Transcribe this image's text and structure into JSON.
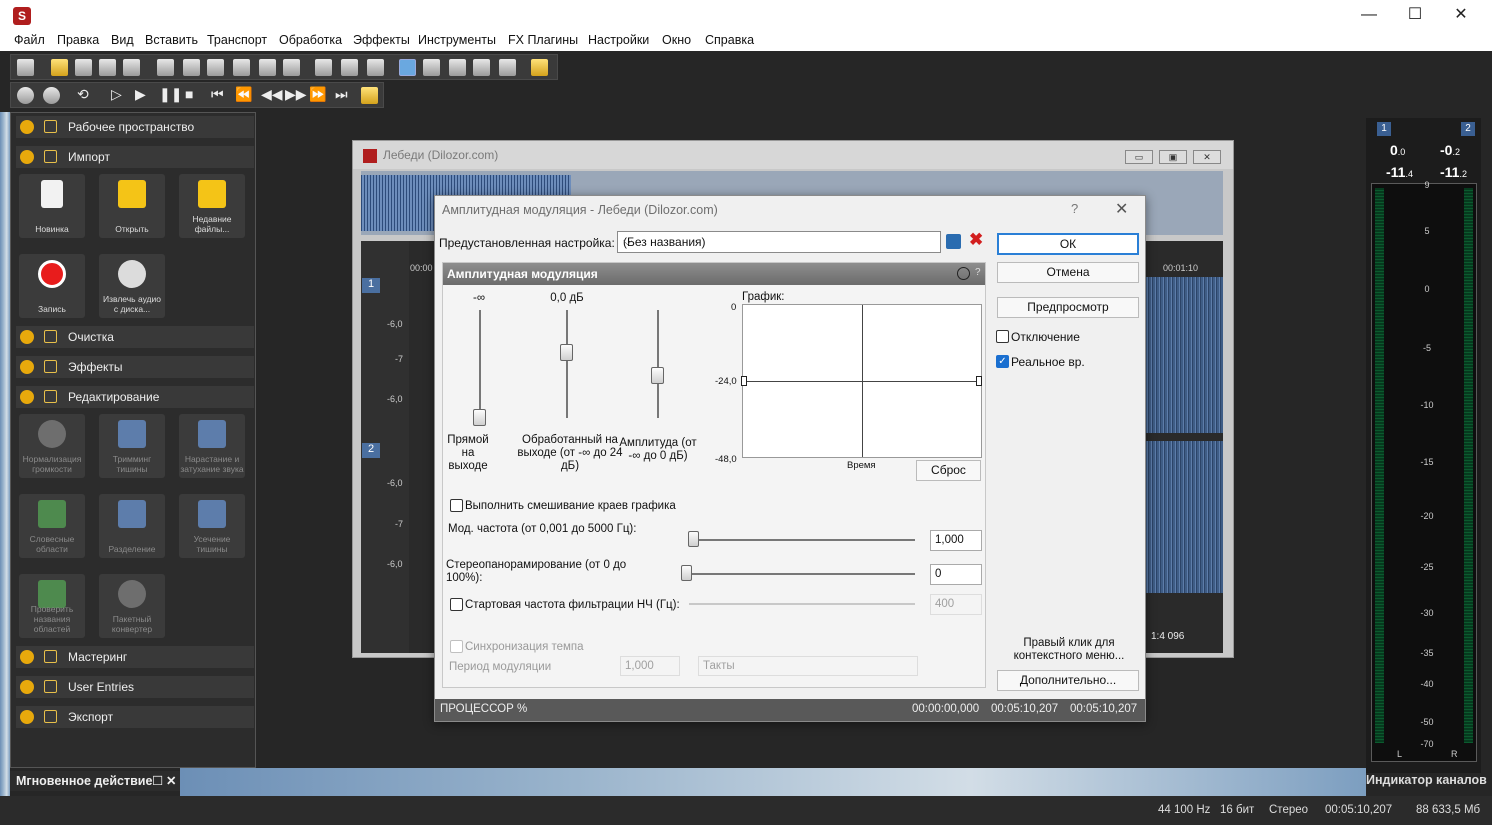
{
  "window": {
    "minimize": "—",
    "maximize": "☐",
    "close": "✕"
  },
  "menu": [
    "Файл",
    "Правка",
    "Вид",
    "Вставить",
    "Транспорт",
    "Обработка",
    "Эффекты",
    "Инструменты",
    "FX Плагины",
    "Настройки",
    "Окно",
    "Справка"
  ],
  "left_panel": {
    "sections": {
      "workspace": "Рабочее пространство",
      "import": "Импорт",
      "cleanup": "Очистка",
      "effects": "Эффекты",
      "editing": "Редактирование",
      "mastering": "Мастеринг",
      "user_entries": "User Entries",
      "export": "Экспорт"
    },
    "import_tiles": [
      "Новинка",
      "Открыть",
      "Недавние файлы...",
      "Запись",
      "Извлечь аудио с диска..."
    ],
    "editing_tiles": [
      "Нормализация громкости",
      "Тримминг тишины",
      "Нарастание и затухание звука",
      "Словесные области",
      "Разделение",
      "Усечение тишины",
      "Проверить названия областей",
      "Пакетный конвертер"
    ],
    "instant_action": "Мгновенное действие"
  },
  "audio_window": {
    "title": "Лебеди (Dilozor.com)",
    "track1": "1",
    "track2": "2",
    "db_labels": [
      "-6,0",
      "-7",
      "-6,0",
      "-6,0",
      "-7",
      "-6,0"
    ],
    "timecode_start": "00:00",
    "timecode_end": "00:01:10",
    "zoom": "1:4 096"
  },
  "dialog": {
    "title": "Амплитудная модуляция - Лебеди (Dilozor.com)",
    "help": "?",
    "close": "✕",
    "preset_label": "Предустановленная настройка:",
    "preset_value": "(Без названия)",
    "ok": "ОК",
    "cancel": "Отмена",
    "preview": "Предпросмотр",
    "bypass": "Отключение",
    "realtime": "Реальное вр.",
    "context_hint": "Правый клик для контекстного меню...",
    "more": "Дополнительно...",
    "plugin": {
      "title": "Амплитудная модуляция",
      "slider1_value": "-∞",
      "slider2_value": "0,0 дБ",
      "slider1_label": "Прямой на выходе",
      "slider2_label": "Обработанный на выходе (от -∞ до 24 дБ)",
      "slider3_label": "Амплитуда (от -∞ до 0 дБ)",
      "graph_label": "График:",
      "graph_y": [
        "0",
        "-24,0",
        "-48,0"
      ],
      "graph_x": "Время",
      "reset": "Сброс",
      "blend_edges": "Выполнить смешивание краев графика",
      "mod_freq_label": "Мод. частота (от 0,001 до 5000 Гц):",
      "mod_freq_value": "1,000",
      "stereo_pan_label": "Стереопанорамирование (от 0 до 100%):",
      "stereo_pan_value": "0",
      "lowpass_label": "Стартовая частота фильтрации НЧ (Гц):",
      "lowpass_value": "400",
      "tempo_sync": "Синхронизация темпа",
      "mod_period_label": "Период модуляции",
      "mod_period_value": "1,000",
      "mod_period_unit": "Такты"
    },
    "status": {
      "cpu": "ПРОЦЕССОР %",
      "t1": "00:00:00,000",
      "t2": "00:05:10,207",
      "t3": "00:05:10,207"
    }
  },
  "meter": {
    "chan1": "1",
    "chan2": "2",
    "peak_l": "0",
    "peak_l_dec": ".0",
    "peak_r": "-0",
    "peak_r_dec": ".2",
    "rms_l": "-11",
    "rms_l_dec": ".4",
    "rms_r": "-11",
    "rms_r_dec": ".2",
    "scale": [
      "9",
      "5",
      "0",
      "-5",
      "-10",
      "-15",
      "-20",
      "-25",
      "-30",
      "-35",
      "-40",
      "-50",
      "-70"
    ],
    "l": "L",
    "r": "R",
    "label": "Индикатор каналов"
  },
  "statusbar": {
    "rate": "44 100 Hz",
    "bits": "16 бит",
    "channels": "Стерео",
    "length": "00:05:10,207",
    "size": "88 633,5 Мб"
  }
}
